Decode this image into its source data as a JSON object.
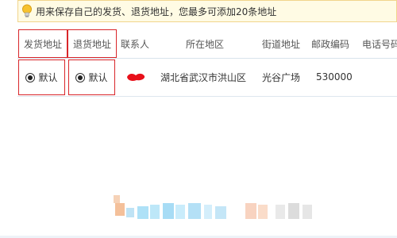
{
  "notice": {
    "icon": "lightbulb-icon",
    "text": "用来保存自己的发货、退货地址，您最多可添加20条地址"
  },
  "table": {
    "headers": {
      "ship_address": "发货地址",
      "return_address": "退货地址",
      "contact": "联系人",
      "region": "所在地区",
      "street": "街道地址",
      "postal": "邮政编码",
      "phone": "电话号码"
    },
    "rows": [
      {
        "ship_default": "默认",
        "return_default": "默认",
        "contact": "",
        "region": "湖北省武汉市洪山区",
        "street": "光谷广场",
        "postal": "530000"
      }
    ]
  },
  "colors": {
    "highlight_border": "#d9262a",
    "notice_bg": "#fffbe4"
  }
}
